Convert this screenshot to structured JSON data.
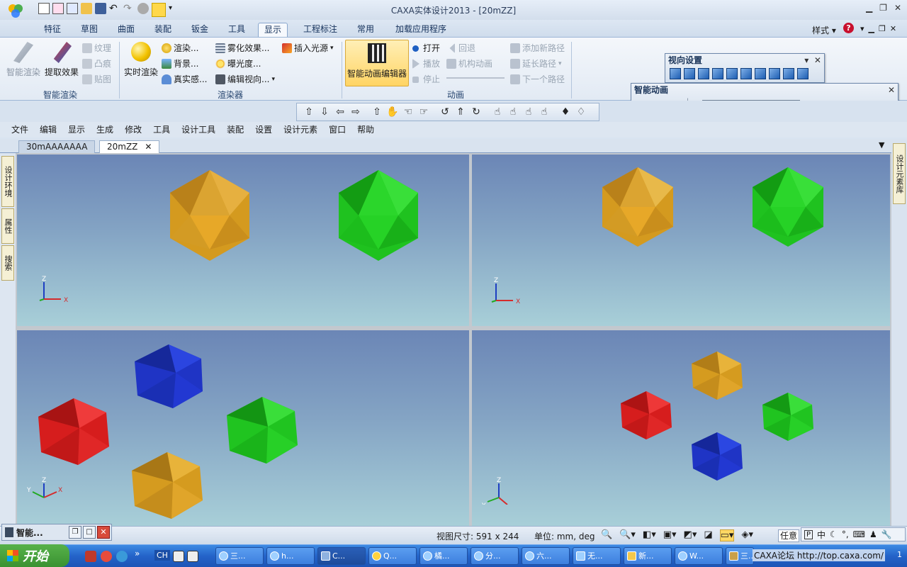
{
  "app": {
    "title": "CAXA实体设计2013 - [20mZZ]",
    "style_label": "样式"
  },
  "ribbon_tabs": [
    "特征",
    "草图",
    "曲面",
    "装配",
    "钣金",
    "工具",
    "显示",
    "工程标注",
    "常用",
    "加载应用程序"
  ],
  "active_ribbon_tab": "显示",
  "ribbon": {
    "smart_render": {
      "group_label": "智能渲染",
      "btn_smart_render": "智能渲染",
      "btn_extract_effect": "提取效果",
      "texture": "纹理",
      "bump": "凸痕",
      "decal": "贴图"
    },
    "renderer": {
      "group_label": "渲染器",
      "btn_realtime": "实时渲染",
      "render": "渲染...",
      "background": "背景...",
      "realism": "真实感...",
      "fog": "雾化效果...",
      "exposure": "曝光度...",
      "edit_view": "编辑视向...",
      "insert_light": "插入光源"
    },
    "animation": {
      "group_label": "动画",
      "btn_editor": "智能动画编辑器",
      "open": "打开",
      "play": "播放",
      "stop": "停止",
      "rewind": "回退",
      "mech_anim": "机构动画",
      "add_path": "添加新路径",
      "extend_path": "延长路径",
      "next_path": "下一个路径"
    }
  },
  "panels": {
    "view_settings": {
      "title": "视向设置"
    },
    "smart_animation": {
      "title": "智能动画"
    }
  },
  "menubar": [
    "文件",
    "编辑",
    "显示",
    "生成",
    "修改",
    "工具",
    "设计工具",
    "装配",
    "设置",
    "设计元素",
    "窗口",
    "帮助"
  ],
  "doc_tabs": [
    "30mAAAAAAA",
    "20mZZ"
  ],
  "active_doc_tab": "20mZZ",
  "left_tabs": [
    "设计环境",
    "属性",
    "搜索"
  ],
  "right_tabs": [
    "设计元素库"
  ],
  "axis_labels": {
    "z": "Z",
    "x": "X",
    "y": "Y"
  },
  "colors": {
    "gold": "#e0a224",
    "green": "#23d123",
    "blue": "#1d34c8",
    "red": "#dd1f1f"
  },
  "statusbar": {
    "smart_box_label": "智能...",
    "view_size_label": "视图尺寸:",
    "view_size_value": "591 x  244",
    "unit_label": "单位: mm, deg",
    "any_label": "任意"
  },
  "taskbar": {
    "start": "开始",
    "items": [
      "三...",
      "h...",
      "C...",
      "Q...",
      "橘...",
      "分...",
      "六...",
      "无...",
      "新...",
      "W...",
      "三..."
    ],
    "active_item": "C...",
    "tray_text": "CAXA论坛 http://top.caxa.com/",
    "tray_time": "1"
  }
}
